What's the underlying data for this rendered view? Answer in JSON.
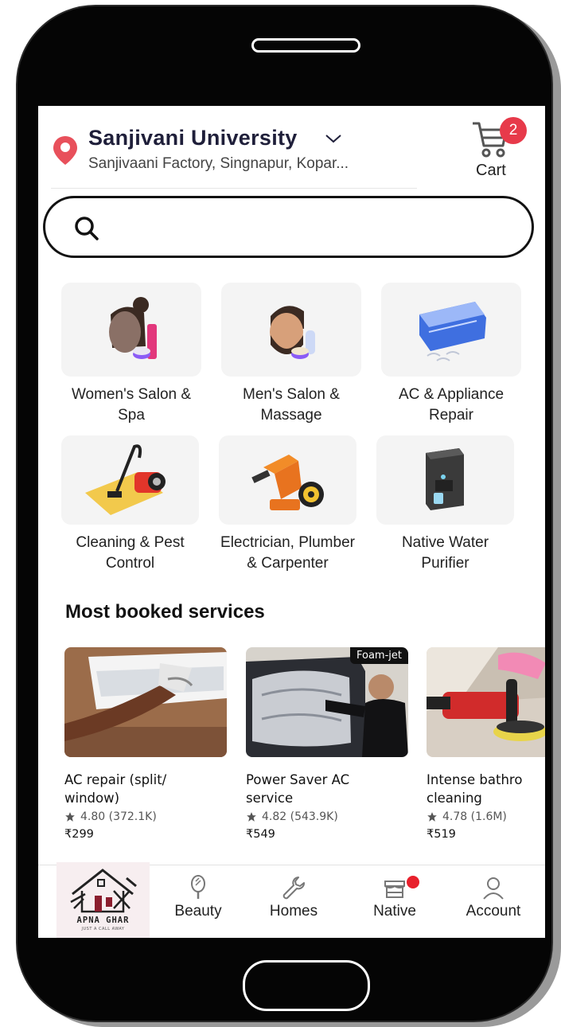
{
  "header": {
    "location_title": "Sanjivani University",
    "location_subtitle": "Sanjivaani Factory, Singnapur, Kopar...",
    "cart_label": "Cart",
    "cart_count": "2"
  },
  "search": {
    "placeholder": ""
  },
  "categories": [
    {
      "label": "Women's Salon & Spa",
      "icon": "women-salon-icon"
    },
    {
      "label": "Men's Salon & Massage",
      "icon": "men-salon-icon"
    },
    {
      "label": "AC & Appliance Repair",
      "icon": "ac-unit-icon"
    },
    {
      "label": "Cleaning & Pest Control",
      "icon": "vacuum-cleaner-icon"
    },
    {
      "label": "Electrician, Plumber & Carpenter",
      "icon": "drill-tape-icon"
    },
    {
      "label": "Native Water Purifier",
      "icon": "water-purifier-icon"
    }
  ],
  "most_booked": {
    "title": "Most booked services",
    "items": [
      {
        "title": "AC repair (split/\nwindow)",
        "rating": "4.80 (372.1K)",
        "price": "₹299",
        "badge": ""
      },
      {
        "title": "Power Saver AC\nservice",
        "rating": "4.82 (543.9K)",
        "price": "₹549",
        "badge": "Foam-jet"
      },
      {
        "title": "Intense bathro\ncleaning",
        "rating": "4.78 (1.6M)",
        "price": "₹519",
        "badge": ""
      }
    ]
  },
  "bottom_nav": {
    "logo_text": "APNA GHAR",
    "logo_tagline": "JUST A CALL AWAY",
    "items": [
      {
        "label": "Beauty",
        "icon": "mirror-icon"
      },
      {
        "label": "Homes",
        "icon": "wrench-icon"
      },
      {
        "label": "Native",
        "icon": "store-icon"
      },
      {
        "label": "Account",
        "icon": "person-icon"
      }
    ]
  },
  "colors": {
    "accent_red": "#e73a4a",
    "pin_red": "#e8505b",
    "text_dark": "#1f1f3a"
  }
}
